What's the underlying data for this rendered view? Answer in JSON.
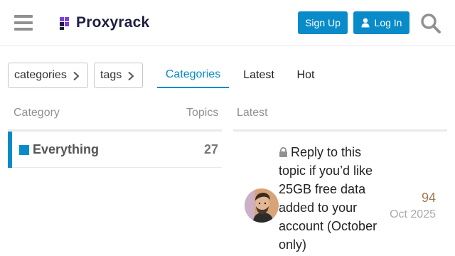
{
  "header": {
    "logo_text": "Proxyrack",
    "signup_label": "Sign Up",
    "login_label": "Log In",
    "colors": {
      "primary": "#0a8bc9",
      "logo_dark": "#1e1e3f",
      "logo_purple": "#7b3fe4"
    }
  },
  "nav": {
    "dropdowns": [
      {
        "label": "categories"
      },
      {
        "label": "tags"
      }
    ],
    "tabs": [
      {
        "label": "Categories",
        "active": true
      },
      {
        "label": "Latest",
        "active": false
      },
      {
        "label": "Hot",
        "active": false
      }
    ]
  },
  "categories_table": {
    "col_category": "Category",
    "col_topics": "Topics",
    "rows": [
      {
        "name": "Everything",
        "topics": "27",
        "color": "#0a8bc9"
      }
    ]
  },
  "latest": {
    "heading": "Latest",
    "topics": [
      {
        "title": "Reply to this topic if you’d like 25GB free data added to your account (October only)",
        "locked": true,
        "count": "94",
        "date": "Oct 2025",
        "icon": "lock-icon"
      }
    ]
  }
}
